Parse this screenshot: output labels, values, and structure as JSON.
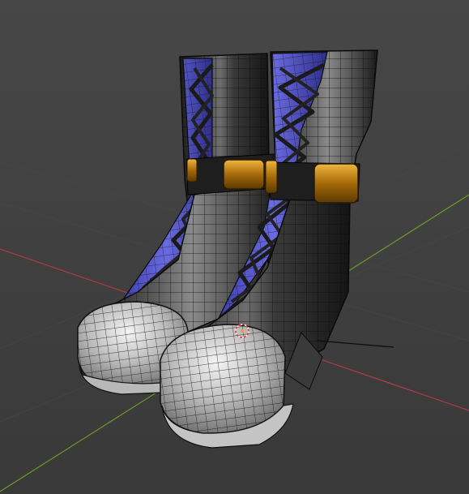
{
  "viewport": {
    "background": "#3d3d3d",
    "background_top": "#484848",
    "grid_color": "#4a4a4a",
    "x_axis_color": "#b03a46",
    "y_axis_color": "#6a9a2a",
    "object_edge_color": "#111111",
    "vamp_color": "#5a5dd6",
    "buckle_color": "#c98a14",
    "toe_color": "#d8d8d8",
    "leather_color": "#2b2b2b"
  },
  "scene": {
    "object": "boots-pair",
    "view": "solid-with-wireframe",
    "origin_marker": "3d-cursor-icon"
  }
}
